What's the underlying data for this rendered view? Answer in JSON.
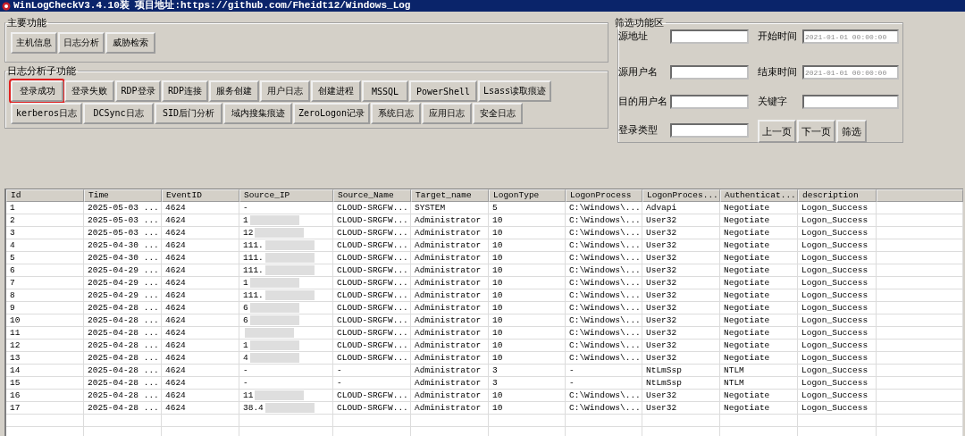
{
  "window": {
    "title": "WinLogCheckV3.4.10装 项目地址:https://github.com/Fheidt12/Windows_Log"
  },
  "main_group": {
    "title": "主要功能",
    "buttons": [
      "主机信息",
      "日志分析",
      "威胁检索"
    ]
  },
  "sub_group": {
    "title": "日志分析子功能",
    "buttons": [
      {
        "label": "登录成功",
        "highlighted": true
      },
      {
        "label": "登录失败",
        "highlighted": false
      },
      {
        "label": "RDP登录",
        "highlighted": false
      },
      {
        "label": "RDP连接",
        "highlighted": false
      },
      {
        "label": "服务创建",
        "highlighted": false
      },
      {
        "label": "用户日志",
        "highlighted": false
      },
      {
        "label": "创建进程",
        "highlighted": false
      },
      {
        "label": "MSSQL",
        "highlighted": false
      },
      {
        "label": "PowerShell",
        "highlighted": false
      },
      {
        "label": "Lsass读取痕迹",
        "highlighted": false
      },
      {
        "label": "kerberos日志",
        "highlighted": false
      },
      {
        "label": "DCSync日志",
        "highlighted": false
      },
      {
        "label": "SID后门分析",
        "highlighted": false
      },
      {
        "label": "域内搜集痕迹",
        "highlighted": false
      },
      {
        "label": "ZeroLogon记录",
        "highlighted": false
      },
      {
        "label": "系统日志",
        "highlighted": false
      },
      {
        "label": "应用日志",
        "highlighted": false
      },
      {
        "label": "安全日志",
        "highlighted": false
      }
    ]
  },
  "filter": {
    "title": "筛选功能区",
    "fields": [
      {
        "label": "源地址"
      },
      {
        "label": "开始时间",
        "value": "2021-01-01 00:00:00"
      },
      {
        "label": "源用户名"
      },
      {
        "label": "结束时间",
        "value": "2021-01-01 00:00:00"
      },
      {
        "label": "目的用户名"
      },
      {
        "label": "关键字"
      },
      {
        "label": "登录类型"
      }
    ],
    "buttons": [
      "上一页",
      "下一页",
      "筛选"
    ]
  },
  "table": {
    "columns": [
      "Id",
      "Time",
      "EventID",
      "Source_IP",
      "Source_Name",
      "Target_name",
      "LogonType",
      "LogonProcess",
      "LogonProces...",
      "Authenticat...",
      "description"
    ],
    "rows": [
      {
        "cells": [
          "1",
          "2025-05-03 ...",
          "4624",
          "-",
          "CLOUD-SRGFW...",
          "SYSTEM",
          "5",
          "C:\\Windows\\...",
          "Advapi",
          "Negotiate",
          "Logon_Success"
        ],
        "redacted": false
      },
      {
        "cells": [
          "2",
          "2025-05-03 ...",
          "4624",
          "1",
          "CLOUD-SRGFW...",
          "Administrator",
          "10",
          "C:\\Windows\\...",
          "User32",
          "Negotiate",
          "Logon_Success"
        ],
        "redacted": true
      },
      {
        "cells": [
          "3",
          "2025-05-03 ...",
          "4624",
          "12",
          "CLOUD-SRGFW...",
          "Administrator",
          "10",
          "C:\\Windows\\...",
          "User32",
          "Negotiate",
          "Logon_Success"
        ],
        "redacted": true
      },
      {
        "cells": [
          "4",
          "2025-04-30 ...",
          "4624",
          "111.",
          "CLOUD-SRGFW...",
          "Administrator",
          "10",
          "C:\\Windows\\...",
          "User32",
          "Negotiate",
          "Logon_Success"
        ],
        "redacted": true
      },
      {
        "cells": [
          "5",
          "2025-04-30 ...",
          "4624",
          "111.",
          "CLOUD-SRGFW...",
          "Administrator",
          "10",
          "C:\\Windows\\...",
          "User32",
          "Negotiate",
          "Logon_Success"
        ],
        "redacted": true
      },
      {
        "cells": [
          "6",
          "2025-04-29 ...",
          "4624",
          "111.",
          "CLOUD-SRGFW...",
          "Administrator",
          "10",
          "C:\\Windows\\...",
          "User32",
          "Negotiate",
          "Logon_Success"
        ],
        "redacted": true
      },
      {
        "cells": [
          "7",
          "2025-04-29 ...",
          "4624",
          "1",
          "CLOUD-SRGFW...",
          "Administrator",
          "10",
          "C:\\Windows\\...",
          "User32",
          "Negotiate",
          "Logon_Success"
        ],
        "redacted": true
      },
      {
        "cells": [
          "8",
          "2025-04-29 ...",
          "4624",
          "111.",
          "CLOUD-SRGFW...",
          "Administrator",
          "10",
          "C:\\Windows\\...",
          "User32",
          "Negotiate",
          "Logon_Success"
        ],
        "redacted": true
      },
      {
        "cells": [
          "9",
          "2025-04-28 ...",
          "4624",
          "6",
          "CLOUD-SRGFW...",
          "Administrator",
          "10",
          "C:\\Windows\\...",
          "User32",
          "Negotiate",
          "Logon_Success"
        ],
        "redacted": true
      },
      {
        "cells": [
          "10",
          "2025-04-28 ...",
          "4624",
          "6",
          "CLOUD-SRGFW...",
          "Administrator",
          "10",
          "C:\\Windows\\...",
          "User32",
          "Negotiate",
          "Logon_Success"
        ],
        "redacted": true
      },
      {
        "cells": [
          "11",
          "2025-04-28 ...",
          "4624",
          "",
          "CLOUD-SRGFW...",
          "Administrator",
          "10",
          "C:\\Windows\\...",
          "User32",
          "Negotiate",
          "Logon_Success"
        ],
        "redacted": true
      },
      {
        "cells": [
          "12",
          "2025-04-28 ...",
          "4624",
          "1",
          "CLOUD-SRGFW...",
          "Administrator",
          "10",
          "C:\\Windows\\...",
          "User32",
          "Negotiate",
          "Logon_Success"
        ],
        "redacted": true
      },
      {
        "cells": [
          "13",
          "2025-04-28 ...",
          "4624",
          "4",
          "CLOUD-SRGFW...",
          "Administrator",
          "10",
          "C:\\Windows\\...",
          "User32",
          "Negotiate",
          "Logon_Success"
        ],
        "redacted": true
      },
      {
        "cells": [
          "14",
          "2025-04-28 ...",
          "4624",
          "-",
          "-",
          "Administrator",
          "3",
          "-",
          "NtLmSsp",
          "NTLM",
          "Logon_Success"
        ],
        "redacted": false
      },
      {
        "cells": [
          "15",
          "2025-04-28 ...",
          "4624",
          "-",
          "-",
          "Administrator",
          "3",
          "-",
          "NtLmSsp",
          "NTLM",
          "Logon_Success"
        ],
        "redacted": false
      },
      {
        "cells": [
          "16",
          "2025-04-28 ...",
          "4624",
          "11",
          "CLOUD-SRGFW...",
          "Administrator",
          "10",
          "C:\\Windows\\...",
          "User32",
          "Negotiate",
          "Logon_Success"
        ],
        "redacted": true
      },
      {
        "cells": [
          "17",
          "2025-04-28 ...",
          "4624",
          "38.4",
          "CLOUD-SRGFW...",
          "Administrator",
          "10",
          "C:\\Windows\\...",
          "User32",
          "Negotiate",
          "Logon_Success"
        ],
        "redacted": true
      }
    ]
  }
}
